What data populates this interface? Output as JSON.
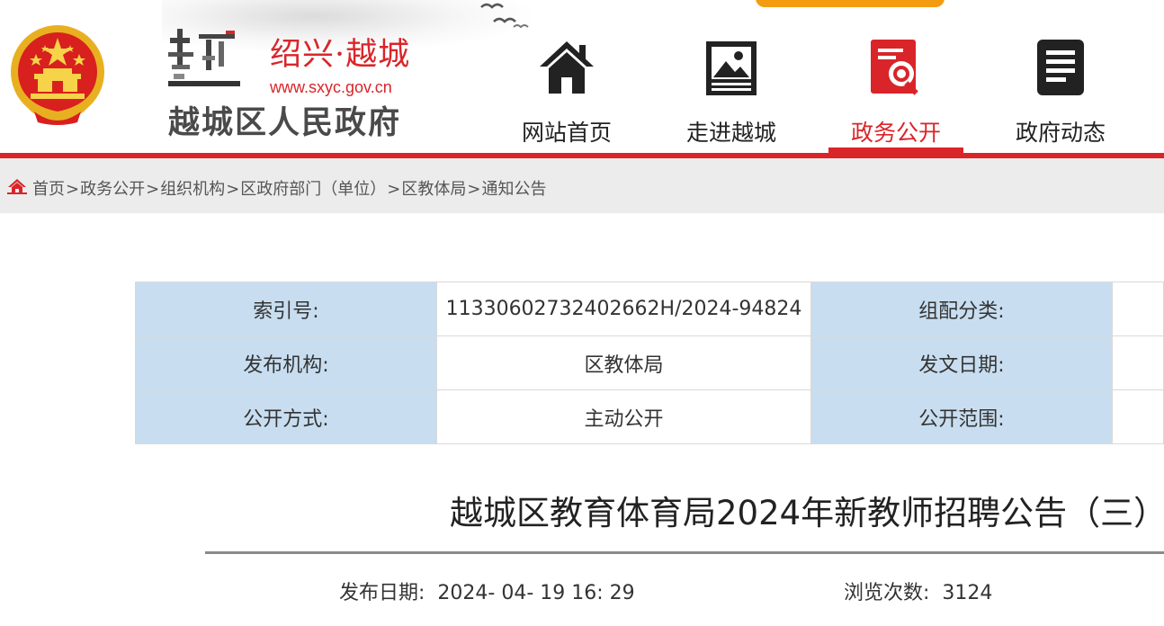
{
  "header": {
    "site_name": "绍兴·越城",
    "site_url": "www.sxyc.gov.cn",
    "gov_name": "越城区人民政府",
    "logo_char": "越"
  },
  "nav": {
    "items": [
      {
        "label": "网站首页",
        "icon": "house-icon",
        "active": false
      },
      {
        "label": "走进越城",
        "icon": "landscape-picture-icon",
        "active": false
      },
      {
        "label": "政务公开",
        "icon": "document-search-icon",
        "active": true
      },
      {
        "label": "政府动态",
        "icon": "news-list-icon",
        "active": false
      }
    ]
  },
  "breadcrumb": {
    "items": [
      "首页",
      "政务公开",
      "组织机构",
      "区政府部门（单位）",
      "区教体局",
      "通知公告"
    ],
    "separator": ">"
  },
  "info": {
    "rows": [
      {
        "label1": "索引号:",
        "value1": "11330602732402662H/2024-94824",
        "label2": "组配分类:",
        "value2": ""
      },
      {
        "label1": "发布机构:",
        "value1": "区教体局",
        "label2": "发文日期:",
        "value2": ""
      },
      {
        "label1": "公开方式:",
        "value1": "主动公开",
        "label2": "公开范围:",
        "value2": ""
      }
    ]
  },
  "article": {
    "title": "越城区教育体育局2024年新教师招聘公告（三）",
    "publish_label": "发布日期:",
    "publish_date": "2024- 04- 19 16: 29",
    "views_label": "浏览次数:",
    "views": "3124"
  },
  "colors": {
    "accent_red": "#d9252a",
    "label_blue": "#c8def0",
    "orange": "#f39c12"
  }
}
